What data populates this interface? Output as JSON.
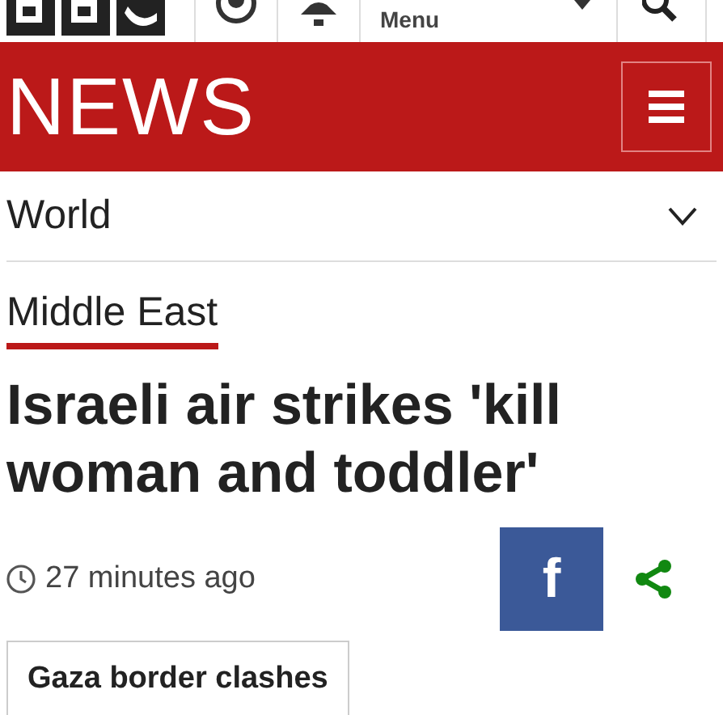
{
  "top_bar": {
    "menu": {
      "label": "Menu"
    }
  },
  "header": {
    "title": "NEWS"
  },
  "section_nav": {
    "label": "World",
    "expanded": false
  },
  "subsection": {
    "label": "Middle East",
    "selected": true
  },
  "article": {
    "headline": "Israeli air strikes 'kill woman and toddler'",
    "time": "27 minutes ago",
    "share_facebook": "f"
  },
  "topic_button": "Gaza border clashes"
}
